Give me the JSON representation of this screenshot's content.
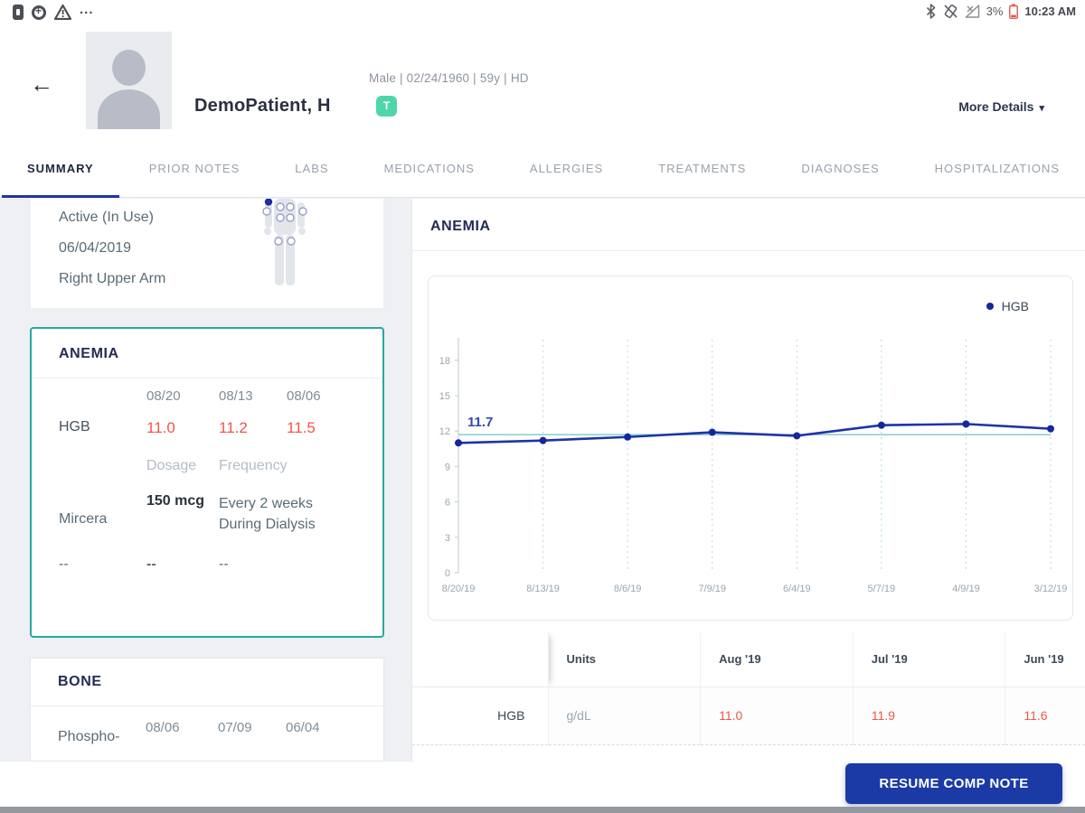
{
  "status_bar": {
    "left_icons": [
      "battery-dock-icon",
      "data-saver-icon",
      "warning-icon"
    ],
    "overflow_dots": "...",
    "battery_percent": "3%",
    "time": "10:23 AM"
  },
  "header": {
    "patient_name": "DemoPatient, H",
    "demographics": "Male | 02/24/1960 | 59y | HD",
    "badge": "T",
    "more_details_label": "More Details"
  },
  "tabs": [
    {
      "label": "SUMMARY",
      "active": true
    },
    {
      "label": "PRIOR NOTES",
      "active": false
    },
    {
      "label": "LABS",
      "active": false
    },
    {
      "label": "MEDICATIONS",
      "active": false
    },
    {
      "label": "ALLERGIES",
      "active": false
    },
    {
      "label": "TREATMENTS",
      "active": false
    },
    {
      "label": "DIAGNOSES",
      "active": false
    },
    {
      "label": "HOSPITALIZATIONS",
      "active": false
    }
  ],
  "access_card": {
    "status": "Active (In Use)",
    "date": "06/04/2019",
    "site": "Right Upper Arm"
  },
  "anemia_card": {
    "title": "ANEMIA",
    "dates": [
      "08/20",
      "08/13",
      "08/06"
    ],
    "lab_label": "HGB",
    "lab_values": [
      "11.0",
      "11.2",
      "11.5"
    ],
    "med_columns": [
      "Dosage",
      "Frequency"
    ],
    "med_name": "Mircera",
    "med_dosage": "150 mcg",
    "med_frequency_1": "Every 2 weeks",
    "med_frequency_2": "During Dialysis",
    "empty_values": [
      "--",
      "--",
      "--"
    ]
  },
  "bone_card": {
    "title": "BONE",
    "lab_label": "Phospho-",
    "dates": [
      "08/06",
      "07/09",
      "06/04"
    ]
  },
  "anemia_section": {
    "title": "ANEMIA"
  },
  "chart_data": {
    "type": "line",
    "x": [
      "8/20/19",
      "8/13/19",
      "8/6/19",
      "7/9/19",
      "6/4/19",
      "5/7/19",
      "4/9/19",
      "3/12/19"
    ],
    "series": [
      {
        "name": "HGB",
        "values": [
          11.0,
          11.2,
          11.5,
          11.9,
          11.6,
          12.5,
          12.6,
          12.2
        ]
      }
    ],
    "yticks": [
      0,
      3,
      6,
      9,
      12,
      15,
      18
    ],
    "ylim": [
      0,
      18.6
    ],
    "reference_line": {
      "value": 11.7,
      "label": "11.7"
    },
    "legend": {
      "position": "top-right",
      "entries": [
        "HGB"
      ]
    },
    "grid": "vertical-dashed",
    "line_color": "#1e34a6",
    "point_color": "#16279d",
    "reference_color": "#8ed1d8",
    "grid_color": "#bce3df",
    "axis_color": "#c9d2d8",
    "tick_label_color": "#98a6b1",
    "annotation_color": "#3448ae"
  },
  "results_table": {
    "columns": [
      "",
      "Units",
      "Aug '19",
      "Jul '19",
      "Jun '19"
    ],
    "rows": [
      {
        "label": "HGB",
        "units": "g/dL",
        "values": [
          "11.0",
          "11.9",
          "11.6"
        ]
      }
    ]
  },
  "footer": {
    "resume_button": "RESUME COMP NOTE"
  }
}
